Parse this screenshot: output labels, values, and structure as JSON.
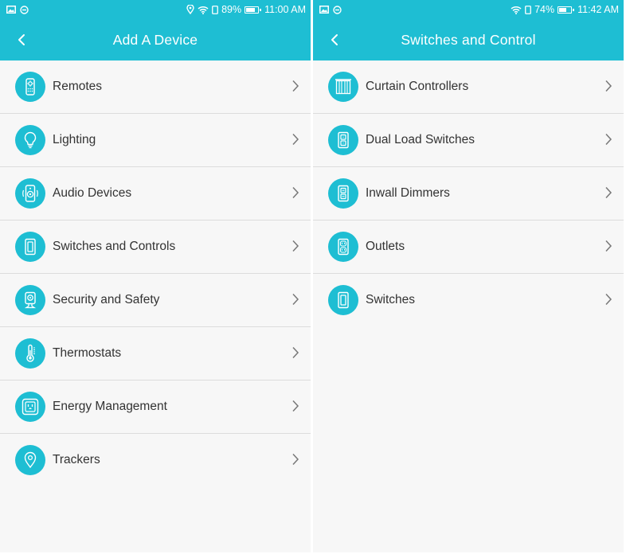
{
  "colors": {
    "accent": "#1ebed3",
    "background": "#f7f7f7",
    "divider": "#dcdcdc",
    "text": "#333333"
  },
  "left": {
    "status": {
      "battery": "89%",
      "time": "11:00 AM",
      "battery_level": 0.89
    },
    "title": "Add A Device",
    "items": [
      {
        "label": "Remotes",
        "icon": "remote-icon"
      },
      {
        "label": "Lighting",
        "icon": "bulb-icon"
      },
      {
        "label": "Audio Devices",
        "icon": "speaker-icon"
      },
      {
        "label": "Switches and Controls",
        "icon": "switch-icon"
      },
      {
        "label": "Security and Safety",
        "icon": "camera-icon"
      },
      {
        "label": "Thermostats",
        "icon": "thermometer-icon"
      },
      {
        "label": "Energy Management",
        "icon": "outlet-icon"
      },
      {
        "label": "Trackers",
        "icon": "location-pin-icon"
      }
    ]
  },
  "right": {
    "status": {
      "battery": "74%",
      "time": "11:42 AM",
      "battery_level": 0.74
    },
    "title": "Switches and Control",
    "items": [
      {
        "label": "Curtain Controllers",
        "icon": "curtain-icon"
      },
      {
        "label": "Dual Load Switches",
        "icon": "dual-switch-icon"
      },
      {
        "label": "Inwall Dimmers",
        "icon": "dimmer-icon"
      },
      {
        "label": "Outlets",
        "icon": "outlet-plate-icon"
      },
      {
        "label": "Switches",
        "icon": "switch-icon"
      }
    ]
  }
}
